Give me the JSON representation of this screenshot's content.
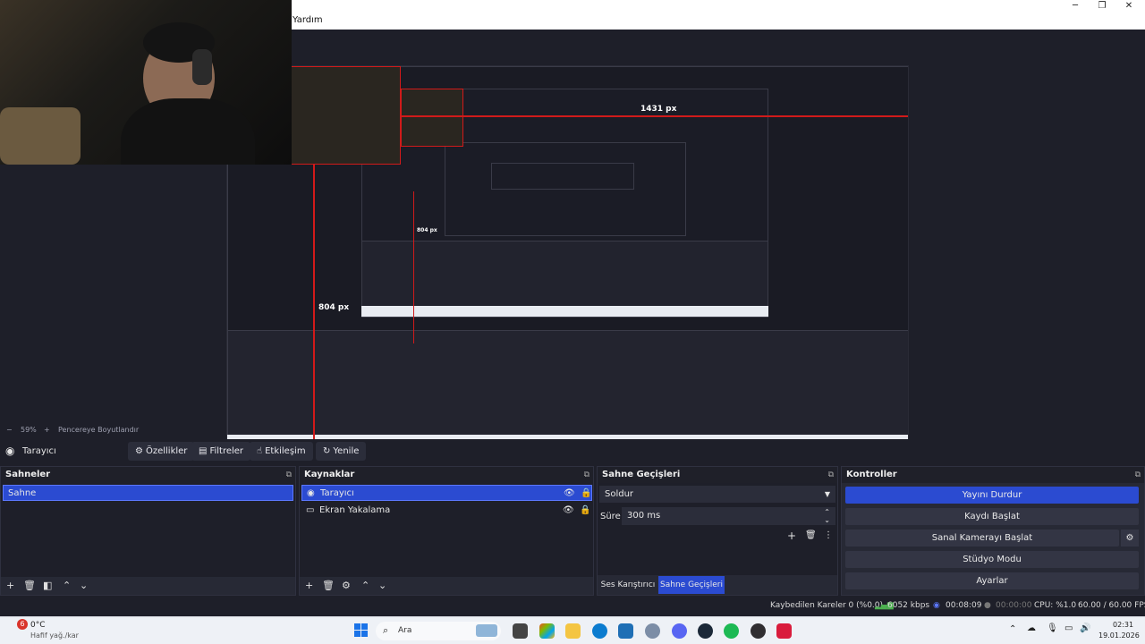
{
  "menu": {
    "help_label": "Yardım"
  },
  "preview": {
    "width_label": "1431 px",
    "height_label": "804 px",
    "inner_height_label": "804 px"
  },
  "zoom": {
    "minus": "−",
    "value": "59%",
    "plus": "+",
    "fit_label": "Pencereye Boyutlandır"
  },
  "source_toolbar": {
    "current_source": "Tarayıcı",
    "properties": "Özellikler",
    "filters": "Filtreler",
    "interact": "Etkileşim",
    "refresh": "Yenile"
  },
  "scenes": {
    "title": "Sahneler",
    "items": [
      "Sahne"
    ]
  },
  "sources": {
    "title": "Kaynaklar",
    "items": [
      "Tarayıcı",
      "Ekran Yakalama"
    ]
  },
  "transitions": {
    "title": "Sahne Geçişleri",
    "selected": "Soldur",
    "duration_label": "Süre",
    "duration_value": "300 ms",
    "tab_mixer": "Ses Karıştırıcı",
    "tab_transitions": "Sahne Geçişleri"
  },
  "controls": {
    "title": "Kontroller",
    "stop_stream": "Yayını Durdur",
    "start_record": "Kaydı Başlat",
    "virtual_cam": "Sanal Kamerayı Başlat",
    "studio_mode": "Stüdyo Modu",
    "settings": "Ayarlar"
  },
  "status": {
    "dropped_frames": "Kaybedilen Kareler 0 (%0.0)",
    "bitrate": "6052 kbps",
    "stream_time": "00:08:09",
    "record_time": "00:00:00",
    "cpu": "CPU: %1.0",
    "fps": "60.00 / 60.00 FPS"
  },
  "taskbar": {
    "weather_temp": "0°C",
    "weather_desc": "Hafif yağ./kar",
    "weather_badge": "6",
    "search_placeholder": "Ara",
    "time": "02:31",
    "date": "19.01.2026"
  },
  "colors": {
    "accent": "#2b4bd1",
    "panel": "#272935",
    "background": "#1e1f29",
    "red_guide": "#d11a1a"
  }
}
